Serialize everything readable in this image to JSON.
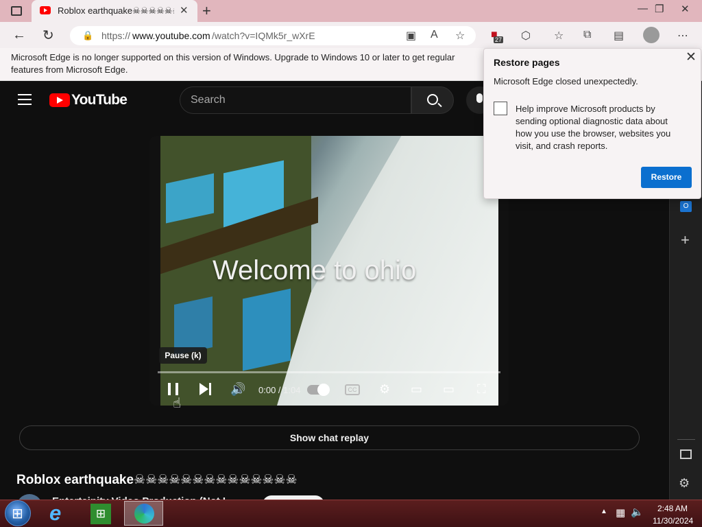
{
  "tab": {
    "title": "Roblox earthquake☠☠☠☠☠☠"
  },
  "address": {
    "prefix": "https://",
    "domain": "www.youtube.com",
    "path": "/watch?v=IQMk5r_wXrE"
  },
  "extensions": {
    "badge_count": "27"
  },
  "info_bar": {
    "text": "Microsoft Edge is no longer supported on this version of Windows. Upgrade to Windows 10 or later to get regular features from Microsoft Edge."
  },
  "youtube": {
    "logo_text": "YouTube",
    "search_placeholder": "Search",
    "video_overlay_text": "Welcome to ohio",
    "tooltip": "Pause (k)",
    "time": "0:00 / 1:04",
    "cc_label": "CC",
    "chat_replay": "Show chat replay",
    "title": "Roblox earthquake☠☠☠☠☠☠☠☠☠☠☠☠☠☠",
    "channel": "Entertainity Video Production (Not L"
  },
  "restore_popup": {
    "title": "Restore pages",
    "message": "Microsoft Edge closed unexpectedly.",
    "checkbox_label": "Help improve Microsoft products by sending optional diagnostic data about how you use the browser, websites you visit, and crash reports.",
    "button": "Restore"
  },
  "taskbar": {
    "time": "2:48 AM",
    "date": "11/30/2024"
  },
  "colors": {
    "accent": "#0b6fcf",
    "youtube_red": "#ff0000",
    "titlebar": "#e1b6bd",
    "taskbar": "#4a1719"
  }
}
